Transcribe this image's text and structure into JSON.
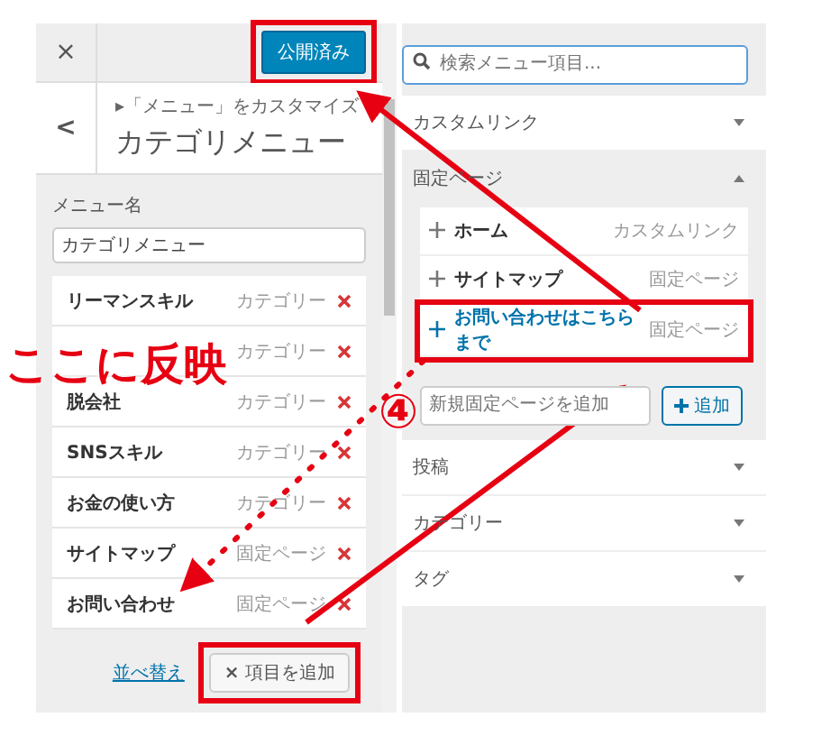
{
  "header": {
    "close": "×",
    "publish_button": {
      "label": "公開済み",
      "annotated": true
    }
  },
  "nav": {
    "back": "<",
    "breadcrumb": "▸「メニュー」をカスタマイズ",
    "title": "カテゴリメニュー"
  },
  "menu_name": {
    "label": "メニュー名",
    "value": "カテゴリメニュー"
  },
  "menu_items": [
    {
      "name": "リーマンスキル",
      "type": "カテゴリー"
    },
    {
      "type": "カテゴリー"
    },
    {
      "name": "脱会社",
      "type": "カテゴリー"
    },
    {
      "name": "SNSスキル",
      "type": "カテゴリー"
    },
    {
      "name": "お金の使い方",
      "type": "カテゴリー"
    },
    {
      "name": "サイトマップ",
      "type": "固定ページ"
    },
    {
      "name": "お問い合わせ",
      "type": "固定ページ"
    }
  ],
  "reorder_link": "並べ替え",
  "add_items_button": {
    "icon": "×",
    "label": "項目を追加",
    "annotated": true
  },
  "search": {
    "placeholder": "検索メニュー項目..."
  },
  "sections": [
    {
      "title": "カスタムリンク",
      "expanded": false
    },
    {
      "title": "固定ページ",
      "expanded": true,
      "items": [
        {
          "label": "ホーム",
          "type": "カスタムリンク",
          "highlighted": false,
          "annotated": false
        },
        {
          "label": "サイトマップ",
          "type": "固定ページ",
          "highlighted": false,
          "annotated": false
        },
        {
          "label": "お問い合わせはこちらまで",
          "type": "固定ページ",
          "highlighted": true,
          "annotated": true
        }
      ],
      "new_page": {
        "placeholder": "新規固定ページを追加",
        "button": "追加"
      }
    },
    {
      "title": "投稿",
      "expanded": false
    },
    {
      "title": "カテゴリー",
      "expanded": false
    },
    {
      "title": "タグ",
      "expanded": false
    }
  ],
  "annotations": {
    "reflect_label": "ここに反映",
    "step_number": "④"
  }
}
